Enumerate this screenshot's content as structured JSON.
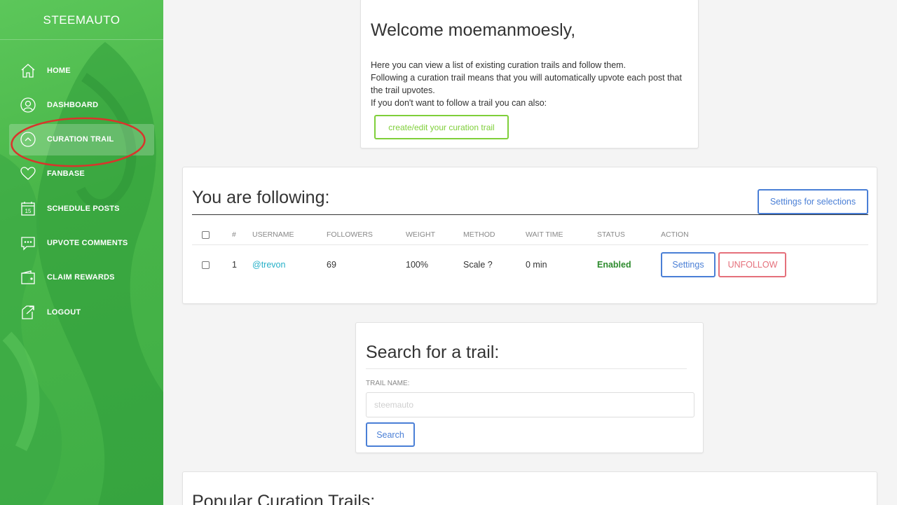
{
  "sidebar": {
    "brand": "STEEMAUTO",
    "items": [
      {
        "label": "HOME",
        "icon": "home-icon"
      },
      {
        "label": "DASHBOARD",
        "icon": "user-icon"
      },
      {
        "label": "CURATION TRAIL",
        "icon": "chevron-up-circle-icon",
        "active": true
      },
      {
        "label": "FANBASE",
        "icon": "heart-icon"
      },
      {
        "label": "SCHEDULE POSTS",
        "icon": "calendar-icon",
        "icon_text": "15"
      },
      {
        "label": "UPVOTE COMMENTS",
        "icon": "comment-icon"
      },
      {
        "label": "CLAIM REWARDS",
        "icon": "wallet-icon"
      },
      {
        "label": "LOGOUT",
        "icon": "logout-icon"
      }
    ]
  },
  "welcome": {
    "title": "Welcome moemanmoesly,",
    "line1": "Here you can view a list of existing curation trails and follow them.",
    "line2": "Following a curation trail means that you will automatically upvote each post that the trail upvotes.",
    "line3": "If you don't want to follow a trail you can also:",
    "button": "create/edit your curation trail"
  },
  "following": {
    "title": "You are following:",
    "settings_button": "Settings for selections",
    "columns": [
      "#",
      "USERNAME",
      "FOLLOWERS",
      "WEIGHT",
      "METHOD",
      "WAIT TIME",
      "STATUS",
      "ACTION"
    ],
    "rows": [
      {
        "num": "1",
        "username": "@trevon",
        "followers": "69",
        "weight": "100%",
        "method": "Scale ?",
        "wait": "0 min",
        "status": "Enabled",
        "settings": "Settings",
        "unfollow": "UNFOLLOW"
      }
    ]
  },
  "search": {
    "title": "Search for a trail:",
    "label": "TRAIL NAME:",
    "placeholder": "steemauto",
    "button": "Search"
  },
  "popular": {
    "title": "Popular Curation Trails:"
  },
  "colors": {
    "sidebar_green": "#48b548",
    "accent_green": "#7fcf3a",
    "accent_blue": "#4a7fd6",
    "danger": "#e5707b",
    "link": "#25b0c8",
    "status_enabled": "#2e8b2e",
    "annotation_red": "#d9342b"
  }
}
